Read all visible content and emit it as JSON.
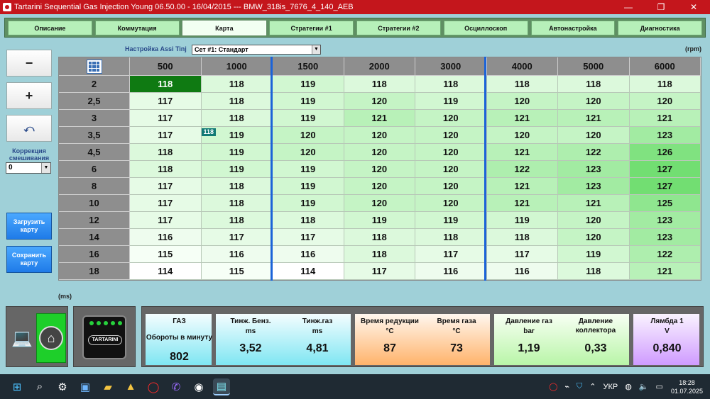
{
  "window": {
    "title": "Tartarini Sequential Gas Injection Young 06.50.00 - 16/04/2015 --- BMW_318is_7676_4_140_AEB",
    "minimize": "—",
    "maximize": "❐",
    "close": "✕"
  },
  "tabs": [
    "Описание",
    "Коммутация",
    "Карта",
    "Стратегии #1",
    "Стратегии #2",
    "Осциллоскоп",
    "Автонастройка",
    "Диагностика"
  ],
  "active_tab": "Карта",
  "side": {
    "minus": "−",
    "plus": "+",
    "undo": "⤺",
    "correction_label": "Коррекция смешивания",
    "correction_value": "0",
    "load_map": "Загрузить карту",
    "save_map": "Сохранить карту"
  },
  "map": {
    "setting_label": "Настройка Assi Tinj",
    "set_value": "Сет #1: Стандарт",
    "rpm_label": "(rpm)",
    "ms_label": "(ms)",
    "selected_tag": "118",
    "columns": [
      "500",
      "1000",
      "1500",
      "2000",
      "3000",
      "4000",
      "5000",
      "6000"
    ],
    "rows": [
      {
        "label": "2",
        "values": [
          "118",
          "118",
          "119",
          "118",
          "118",
          "118",
          "118",
          "118"
        ]
      },
      {
        "label": "2,5",
        "values": [
          "117",
          "118",
          "119",
          "120",
          "119",
          "120",
          "120",
          "120"
        ]
      },
      {
        "label": "3",
        "values": [
          "117",
          "118",
          "119",
          "121",
          "120",
          "121",
          "121",
          "121"
        ]
      },
      {
        "label": "3,5",
        "values": [
          "117",
          "119",
          "120",
          "120",
          "120",
          "120",
          "120",
          "123"
        ]
      },
      {
        "label": "4,5",
        "values": [
          "118",
          "119",
          "120",
          "120",
          "120",
          "121",
          "122",
          "126"
        ]
      },
      {
        "label": "6",
        "values": [
          "118",
          "119",
          "119",
          "120",
          "120",
          "122",
          "123",
          "127"
        ]
      },
      {
        "label": "8",
        "values": [
          "117",
          "118",
          "119",
          "120",
          "120",
          "121",
          "123",
          "127"
        ]
      },
      {
        "label": "10",
        "values": [
          "117",
          "118",
          "119",
          "120",
          "120",
          "121",
          "121",
          "125"
        ]
      },
      {
        "label": "12",
        "values": [
          "117",
          "118",
          "118",
          "119",
          "119",
          "119",
          "120",
          "123"
        ]
      },
      {
        "label": "14",
        "values": [
          "116",
          "117",
          "117",
          "118",
          "118",
          "118",
          "120",
          "123"
        ]
      },
      {
        "label": "16",
        "values": [
          "115",
          "116",
          "116",
          "118",
          "117",
          "117",
          "119",
          "122"
        ]
      },
      {
        "label": "18",
        "values": [
          "114",
          "115",
          "114",
          "117",
          "116",
          "116",
          "118",
          "121"
        ]
      }
    ]
  },
  "gauges": {
    "gas_title": "ГАЗ",
    "rpm_title": "Обороты в минуту",
    "rpm_value": "802",
    "inj_petrol_title": "Тинж. Бенз.",
    "inj_petrol_unit": "ms",
    "inj_petrol_value": "3,52",
    "inj_gas_title": "Тинж.газ",
    "inj_gas_unit": "ms",
    "inj_gas_value": "4,81",
    "reducer_time_title": "Время редукции",
    "reducer_unit": "°C",
    "reducer_value": "87",
    "gas_time_title": "Время газа",
    "gas_time_unit": "°C",
    "gas_time_value": "73",
    "gas_pressure_title": "Давление газ",
    "gas_pressure_unit": "bar",
    "gas_pressure_value": "1,19",
    "manifold_title": "Давление коллектора",
    "manifold_value": "0,33",
    "lambda_title": "Лямбда 1",
    "lambda_unit": "V",
    "lambda_value": "0,840"
  },
  "device": {
    "logo": "TARTARINI"
  },
  "taskbar": {
    "lang": "УКР",
    "time": "18:28",
    "date": "01.07.2025"
  }
}
